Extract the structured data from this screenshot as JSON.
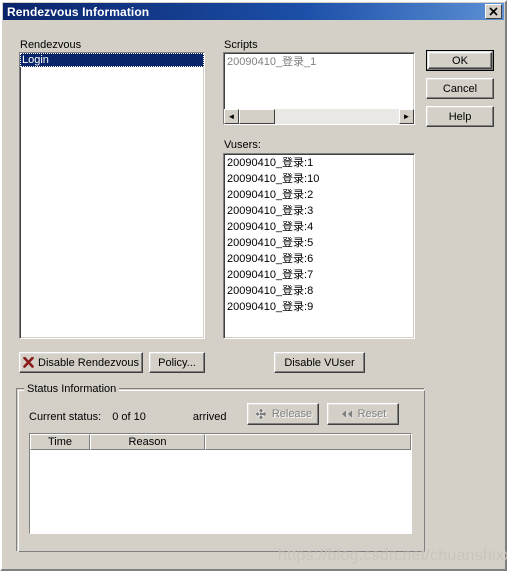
{
  "window": {
    "title": "Rendezvous Information",
    "close_label": "✕"
  },
  "rendezvous": {
    "label": "Rendezvous",
    "items": [
      {
        "name": "Login",
        "selected": true
      }
    ]
  },
  "scripts": {
    "label": "Scripts",
    "value": "20090410_登录_1",
    "scroll_left_glyph": "◄",
    "scroll_right_glyph": "►"
  },
  "vusers": {
    "label": "Vusers:",
    "items": [
      "20090410_登录:1",
      "20090410_登录:10",
      "20090410_登录:2",
      "20090410_登录:3",
      "20090410_登录:4",
      "20090410_登录:5",
      "20090410_登录:6",
      "20090410_登录:7",
      "20090410_登录:8",
      "20090410_登录:9"
    ]
  },
  "buttons": {
    "ok": "OK",
    "cancel": "Cancel",
    "help": "Help",
    "disable_rendezvous": "Disable Rendezvous",
    "policy": "Policy...",
    "disable_vuser": "Disable VUser",
    "release": "Release",
    "reset": "Reset"
  },
  "status": {
    "group_title": "Status Information",
    "current_status_label": "Current status:",
    "current_status_count": "0 of 10",
    "current_status_arrived": "arrived",
    "table": {
      "columns": [
        "Time",
        "Reason",
        ""
      ],
      "rows": []
    }
  },
  "watermark": "https://blog.csdn.net/chuanshixx",
  "colors": {
    "titlebar_start": "#0a246a",
    "titlebar_end": "#5d90d4",
    "dialog_face": "#d4d0c8",
    "selection": "#0a246a",
    "disabled_text": "#808080",
    "disable_icon": "#8b1a1a",
    "watermark": "#c9c5bc"
  }
}
